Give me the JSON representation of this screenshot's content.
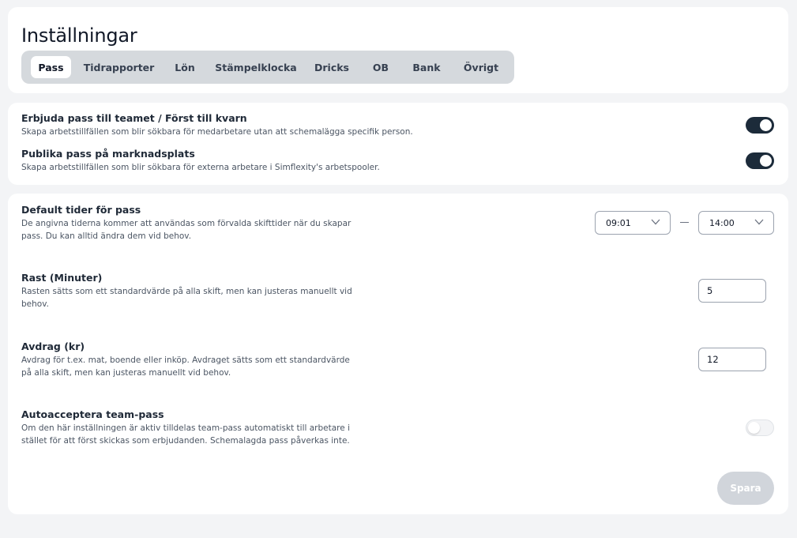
{
  "page": {
    "title": "Inställningar"
  },
  "tabs": [
    {
      "label": "Pass",
      "active": true
    },
    {
      "label": "Tidrapporter"
    },
    {
      "label": "Lön"
    },
    {
      "label": "Stämpelklocka"
    },
    {
      "label": "Dricks"
    },
    {
      "label": "OB"
    },
    {
      "label": "Bank"
    },
    {
      "label": "Övrigt"
    }
  ],
  "toggles": {
    "offer_team": {
      "title": "Erbjuda pass till teamet / Först till kvarn",
      "description": "Skapa arbetstillfällen som blir sökbara för medarbetare utan att schemalägga specifik person.",
      "on": true
    },
    "marketplace": {
      "title": "Publika pass på marknadsplats",
      "description": "Skapa arbetstillfällen som blir sökbara för externa arbetare i Simflexity's arbetspooler.",
      "on": true
    }
  },
  "defaults": {
    "times": {
      "title": "Default tider för pass",
      "description": "De angivna tiderna kommer att användas som förvalda skifttider när du skapar pass. Du kan alltid ändra dem vid behov.",
      "start": "09:01",
      "end": "14:00"
    },
    "break": {
      "title": "Rast (Minuter)",
      "description": "Rasten sätts som ett standardvärde på alla skift, men kan justeras manuellt vid behov.",
      "value": "5"
    },
    "deduction": {
      "title": "Avdrag (kr)",
      "description": "Avdrag för t.ex. mat, boende eller inköp. Avdraget sätts som ett standardvärde på alla skift, men kan justeras manuellt vid behov.",
      "value": "12"
    },
    "auto_accept": {
      "title": "Autoacceptera team-pass",
      "description": "Om den här inställningen är aktiv tilldelas team-pass automatiskt till arbetare i stället för att först skickas som erbjudanden. Schemalagda pass påverkas inte.",
      "on": false
    },
    "save_label": "Spara"
  },
  "colors": {
    "toggle_on": "#1c2b3a",
    "tab_bar": "#d5d9dd",
    "save_disabled": "#d1d5db"
  }
}
